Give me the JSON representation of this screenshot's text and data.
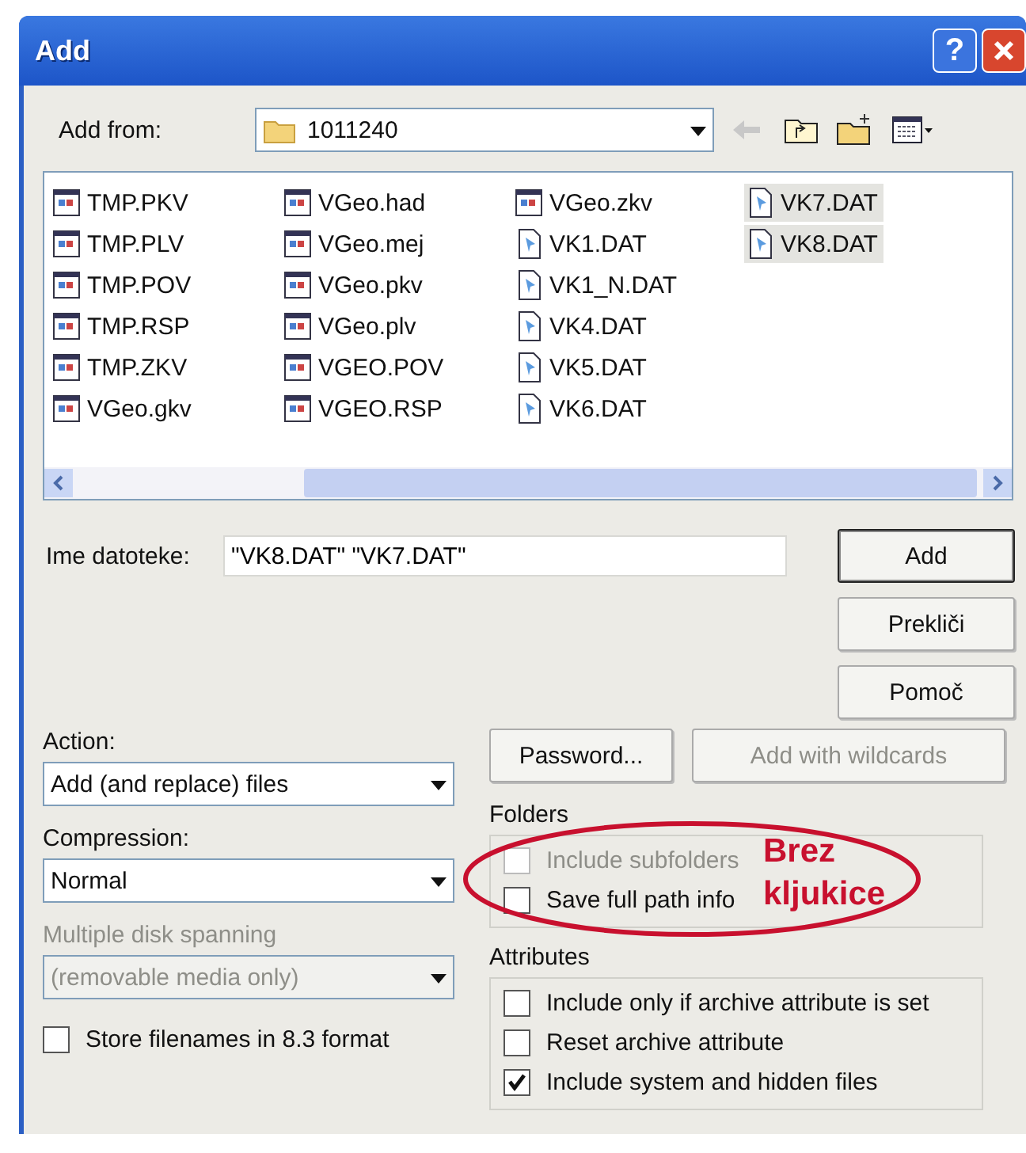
{
  "window": {
    "title": "Add"
  },
  "title_buttons": [
    {
      "kind": "help",
      "label": "?"
    },
    {
      "kind": "close"
    }
  ],
  "add_from": {
    "label": "Add from:",
    "value": "1011240"
  },
  "files": [
    {
      "name": "TMP.PKV",
      "kind": "app",
      "selected": false
    },
    {
      "name": "TMP.PLV",
      "kind": "app",
      "selected": false
    },
    {
      "name": "TMP.POV",
      "kind": "app",
      "selected": false
    },
    {
      "name": "TMP.RSP",
      "kind": "app",
      "selected": false
    },
    {
      "name": "TMP.ZKV",
      "kind": "app",
      "selected": false
    },
    {
      "name": "VGeo.gkv",
      "kind": "app",
      "selected": false
    },
    {
      "name": "VGeo.had",
      "kind": "app",
      "selected": false
    },
    {
      "name": "VGeo.mej",
      "kind": "app",
      "selected": false
    },
    {
      "name": "VGeo.pkv",
      "kind": "app",
      "selected": false
    },
    {
      "name": "VGeo.plv",
      "kind": "app",
      "selected": false
    },
    {
      "name": "VGEO.POV",
      "kind": "app",
      "selected": false
    },
    {
      "name": "VGEO.RSP",
      "kind": "app",
      "selected": false
    },
    {
      "name": "VGeo.zkv",
      "kind": "app",
      "selected": false
    },
    {
      "name": "VK1.DAT",
      "kind": "data",
      "selected": false
    },
    {
      "name": "VK1_N.DAT",
      "kind": "data",
      "selected": false
    },
    {
      "name": "VK4.DAT",
      "kind": "data",
      "selected": false
    },
    {
      "name": "VK5.DAT",
      "kind": "data",
      "selected": false
    },
    {
      "name": "VK6.DAT",
      "kind": "data",
      "selected": false
    },
    {
      "name": "VK7.DAT",
      "kind": "data",
      "selected": true
    },
    {
      "name": "VK8.DAT",
      "kind": "data",
      "selected": true
    }
  ],
  "file_name": {
    "label": "Ime datoteke:",
    "value": "\"VK8.DAT\" \"VK7.DAT\""
  },
  "buttons": [
    {
      "label": "Add",
      "default": true
    },
    {
      "label": "Prekliči",
      "default": false
    },
    {
      "label": "Pomoč",
      "default": false
    }
  ],
  "action": {
    "label": "Action:",
    "value": "Add (and replace) files"
  },
  "compression": {
    "label": "Compression:",
    "value": "Normal"
  },
  "spanning": {
    "label": "Multiple disk spanning",
    "value": "(removable media only)",
    "disabled": true
  },
  "store_83": {
    "label": "Store filenames in 8.3 format",
    "checked": false
  },
  "side_buttons": [
    {
      "label": "Password...",
      "disabled": false
    },
    {
      "label": "Add with wildcards",
      "disabled": true
    }
  ],
  "folders": {
    "title": "Folders",
    "options": [
      {
        "label": "Include subfolders",
        "checked": false,
        "disabled": true
      },
      {
        "label": "Save full path info",
        "checked": false,
        "disabled": false
      }
    ]
  },
  "attributes": {
    "title": "Attributes",
    "options": [
      {
        "label": "Include only if archive attribute is set",
        "checked": false,
        "disabled": false
      },
      {
        "label": "Reset archive attribute",
        "checked": false,
        "disabled": false
      },
      {
        "label": "Include system and hidden files",
        "checked": true,
        "disabled": false
      }
    ]
  },
  "annotation": {
    "text": "Brez kljukice"
  }
}
